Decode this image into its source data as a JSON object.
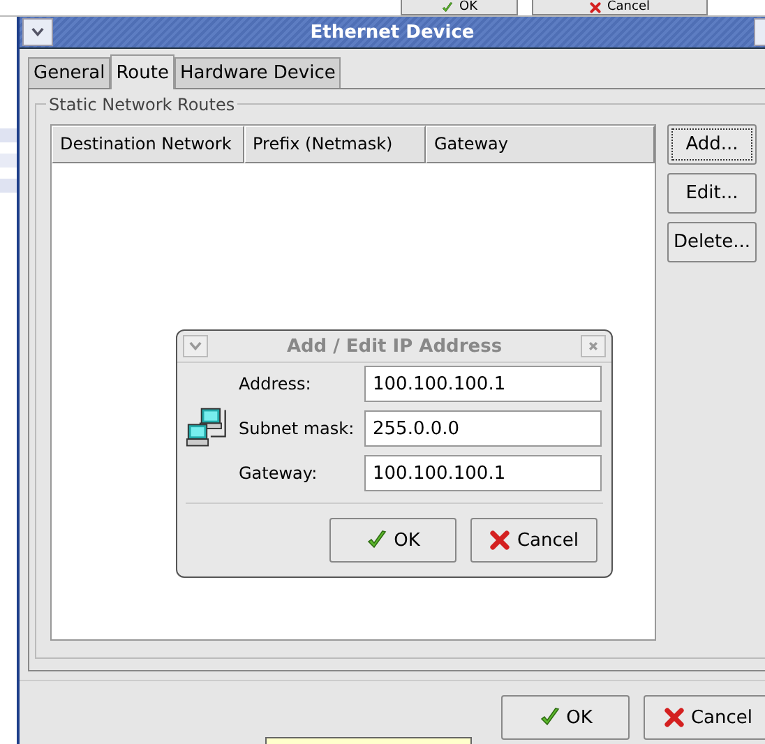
{
  "background_dialog": {
    "buttons": [
      {
        "kind": "ok",
        "label": "OK"
      },
      {
        "kind": "cancel",
        "label": "Cancel"
      }
    ]
  },
  "window": {
    "title": "Ethernet Device"
  },
  "tabs": [
    {
      "label": "General",
      "selected": false
    },
    {
      "label": "Route",
      "selected": true
    },
    {
      "label": "Hardware Device",
      "selected": false
    }
  ],
  "frame": {
    "title": "Static Network Routes"
  },
  "table": {
    "columns": [
      "Destination Network",
      "Prefix (Netmask)",
      "Gateway"
    ]
  },
  "side_buttons": [
    {
      "label": "Add...",
      "focused": true
    },
    {
      "label": "Edit...",
      "focused": false
    },
    {
      "label": "Delete...",
      "focused": false
    }
  ],
  "dialog": {
    "title": "Add / Edit IP Address",
    "fields": [
      {
        "label": "Address:",
        "value": "100.100.100.1"
      },
      {
        "label": "Subnet mask:",
        "value": "255.0.0.0"
      },
      {
        "label": "Gateway:",
        "value": "100.100.100.1"
      }
    ],
    "buttons": [
      {
        "kind": "ok",
        "label": "OK"
      },
      {
        "kind": "cancel",
        "label": "Cancel"
      }
    ]
  },
  "buttons": [
    {
      "kind": "ok",
      "label": "OK"
    },
    {
      "kind": "cancel",
      "label": "Cancel"
    }
  ]
}
